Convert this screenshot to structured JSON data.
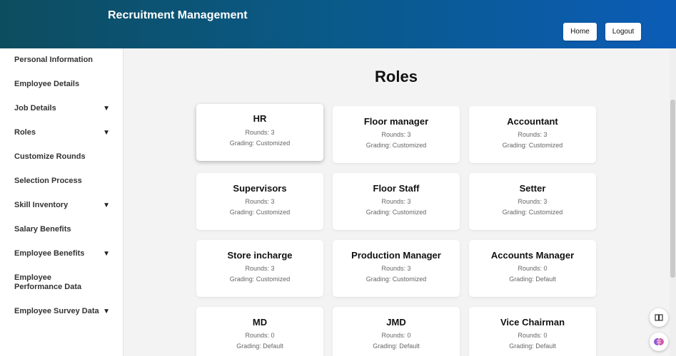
{
  "header": {
    "title": "Recruitment Management",
    "home_label": "Home",
    "logout_label": "Logout"
  },
  "sidebar": {
    "items": [
      {
        "label": "Personal Information",
        "arrow": ""
      },
      {
        "label": "Employee Details",
        "arrow": ""
      },
      {
        "label": "Job Details",
        "arrow": "▼"
      },
      {
        "label": "Roles",
        "arrow": "▼"
      },
      {
        "label": "Customize Rounds",
        "arrow": ""
      },
      {
        "label": "Selection Process",
        "arrow": ""
      },
      {
        "label": "Skill Inventory",
        "arrow": "▼"
      },
      {
        "label": "Salary Benefits",
        "arrow": ""
      },
      {
        "label": "Employee Benefits",
        "arrow": "▼"
      },
      {
        "label": "Employee Performance Data",
        "arrow": ""
      },
      {
        "label": "Employee Survey Data",
        "arrow": "▼"
      }
    ]
  },
  "main": {
    "title": "Roles",
    "roles": [
      {
        "name": "HR",
        "rounds": "Rounds: 3",
        "grading": "Grading: Customized"
      },
      {
        "name": "Floor manager",
        "rounds": "Rounds: 3",
        "grading": "Grading: Customized"
      },
      {
        "name": "Accountant",
        "rounds": "Rounds: 3",
        "grading": "Grading: Customized"
      },
      {
        "name": "Supervisors",
        "rounds": "Rounds: 3",
        "grading": "Grading: Customized"
      },
      {
        "name": "Floor Staff",
        "rounds": "Rounds: 3",
        "grading": "Grading: Customized"
      },
      {
        "name": "Setter",
        "rounds": "Rounds: 3",
        "grading": "Grading: Customized"
      },
      {
        "name": "Store incharge",
        "rounds": "Rounds: 3",
        "grading": "Grading: Customized"
      },
      {
        "name": "Production Manager",
        "rounds": "Rounds: 3",
        "grading": "Grading: Customized"
      },
      {
        "name": "Accounts Manager",
        "rounds": "Rounds: 0",
        "grading": "Grading: Default"
      },
      {
        "name": "MD",
        "rounds": "Rounds: 0",
        "grading": "Grading: Default"
      },
      {
        "name": "JMD",
        "rounds": "Rounds: 0",
        "grading": "Grading: Default"
      },
      {
        "name": "Vice Chairman",
        "rounds": "Rounds: 0",
        "grading": "Grading: Default"
      }
    ]
  },
  "floating": {
    "top_icon": "book-icon",
    "bottom_icon": "brain-icon"
  },
  "colors": {
    "header_start": "#0d4d5f",
    "header_end": "#0b5cb6",
    "background": "#f3f3f3"
  }
}
